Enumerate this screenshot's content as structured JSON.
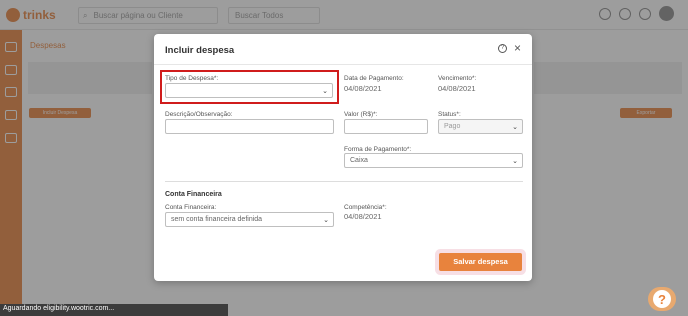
{
  "app": {
    "logo_text": "trinks",
    "search_placeholder": "Buscar página ou Cliente",
    "search2_placeholder": "Buscar Todos",
    "page_title": "Despesas",
    "left_action_label": "Incluir Despesa",
    "right_action_label": "Exportar",
    "accent_color": "#e8833d"
  },
  "modal": {
    "title": "Incluir despesa",
    "fields": {
      "tipo_despesa": {
        "label": "Tipo de Despesa*:",
        "value": ""
      },
      "data_pagamento": {
        "label": "Data de Pagamento:",
        "value": "04/08/2021"
      },
      "vencimento": {
        "label": "Vencimento*:",
        "value": "04/08/2021"
      },
      "descricao": {
        "label": "Descrição/Observação:",
        "value": ""
      },
      "valor": {
        "label": "Valor (R$)*:",
        "value": ""
      },
      "status": {
        "label": "Status*:",
        "value": "Pago"
      },
      "forma_pagamento": {
        "label": "Forma de Pagamento*:",
        "value": "Caixa"
      }
    },
    "conta_financeira_section": {
      "title": "Conta Financeira",
      "conta": {
        "label": "Conta Financeira:",
        "value": "sem conta financeira definida"
      },
      "competencia": {
        "label": "Competência*:",
        "value": "04/08/2021"
      }
    },
    "save_label": "Salvar despesa"
  },
  "status_bar": {
    "text": "Aguardando eligibility.wootric.com..."
  },
  "help_fab": {
    "glyph": "?"
  }
}
